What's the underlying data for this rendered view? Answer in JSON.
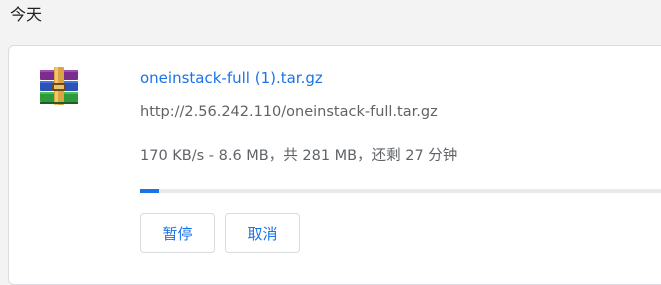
{
  "section_heading": "今天",
  "download": {
    "icon": "rar-archive-icon",
    "file_name": "oneinstack-full (1).tar.gz",
    "url": "http://2.56.242.110/oneinstack-full.tar.gz",
    "status": "170 KB/s - 8.6 MB，共 281 MB，还剩 27 分钟",
    "progress_fraction": 0.035,
    "pause_label": "暂停",
    "cancel_label": "取消"
  },
  "colors": {
    "accent": "#1a73e8",
    "secondary_text": "#5f6368",
    "border": "#dadce0",
    "background": "#f3f3f3"
  }
}
